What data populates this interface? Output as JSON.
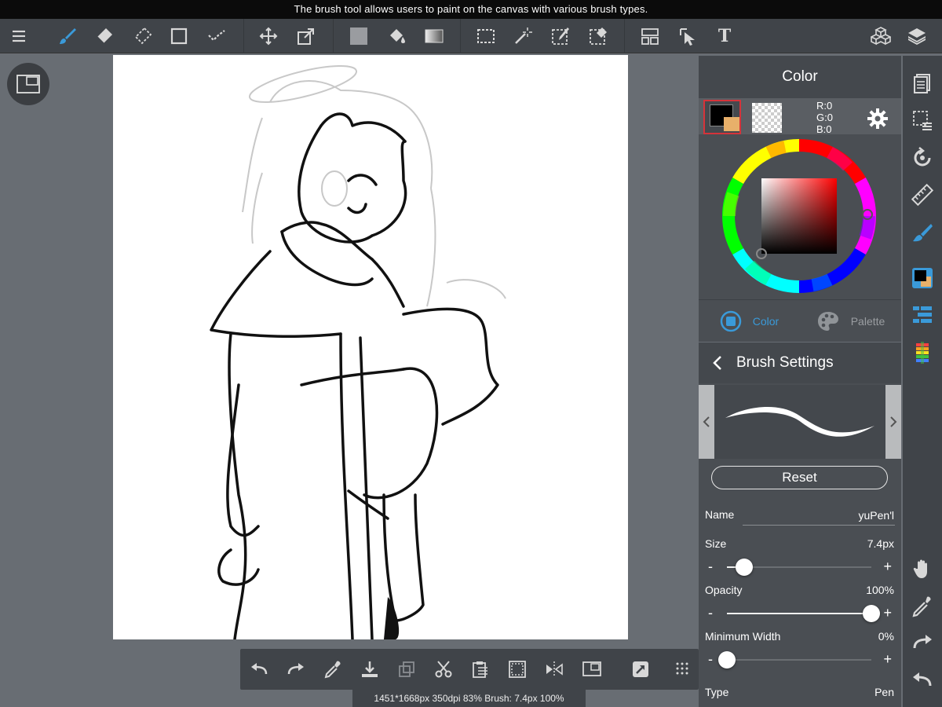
{
  "caption": "The brush tool allows users to paint on the canvas with various brush types.",
  "toolbar": {
    "text_tool_label": "T",
    "colors": {
      "active_brush": "#3a9ad9",
      "bg": "#404449"
    }
  },
  "color_panel": {
    "title": "Color",
    "rgb": {
      "r": "R:0",
      "g": "G:0",
      "b": "B:0"
    },
    "main_color": "#000000",
    "secondary_color": "#e8b06a",
    "tabs": [
      {
        "label": "Color",
        "active": true
      },
      {
        "label": "Palette",
        "active": false
      }
    ]
  },
  "brush_settings": {
    "title": "Brush Settings",
    "reset_label": "Reset",
    "name_label": "Name",
    "name_value": "yuPen'l",
    "size_label": "Size",
    "size_value": "7.4px",
    "size_fraction": 0.12,
    "opacity_label": "Opacity",
    "opacity_value": "100%",
    "opacity_fraction": 1.0,
    "minwidth_label": "Minimum Width",
    "minwidth_value": "0%",
    "minwidth_fraction": 0.0,
    "type_label": "Type",
    "type_value": "Pen",
    "minus": "-",
    "plus": "+"
  },
  "status_bar": "1451*1668px 350dpi 83% Brush: 7.4px 100%"
}
